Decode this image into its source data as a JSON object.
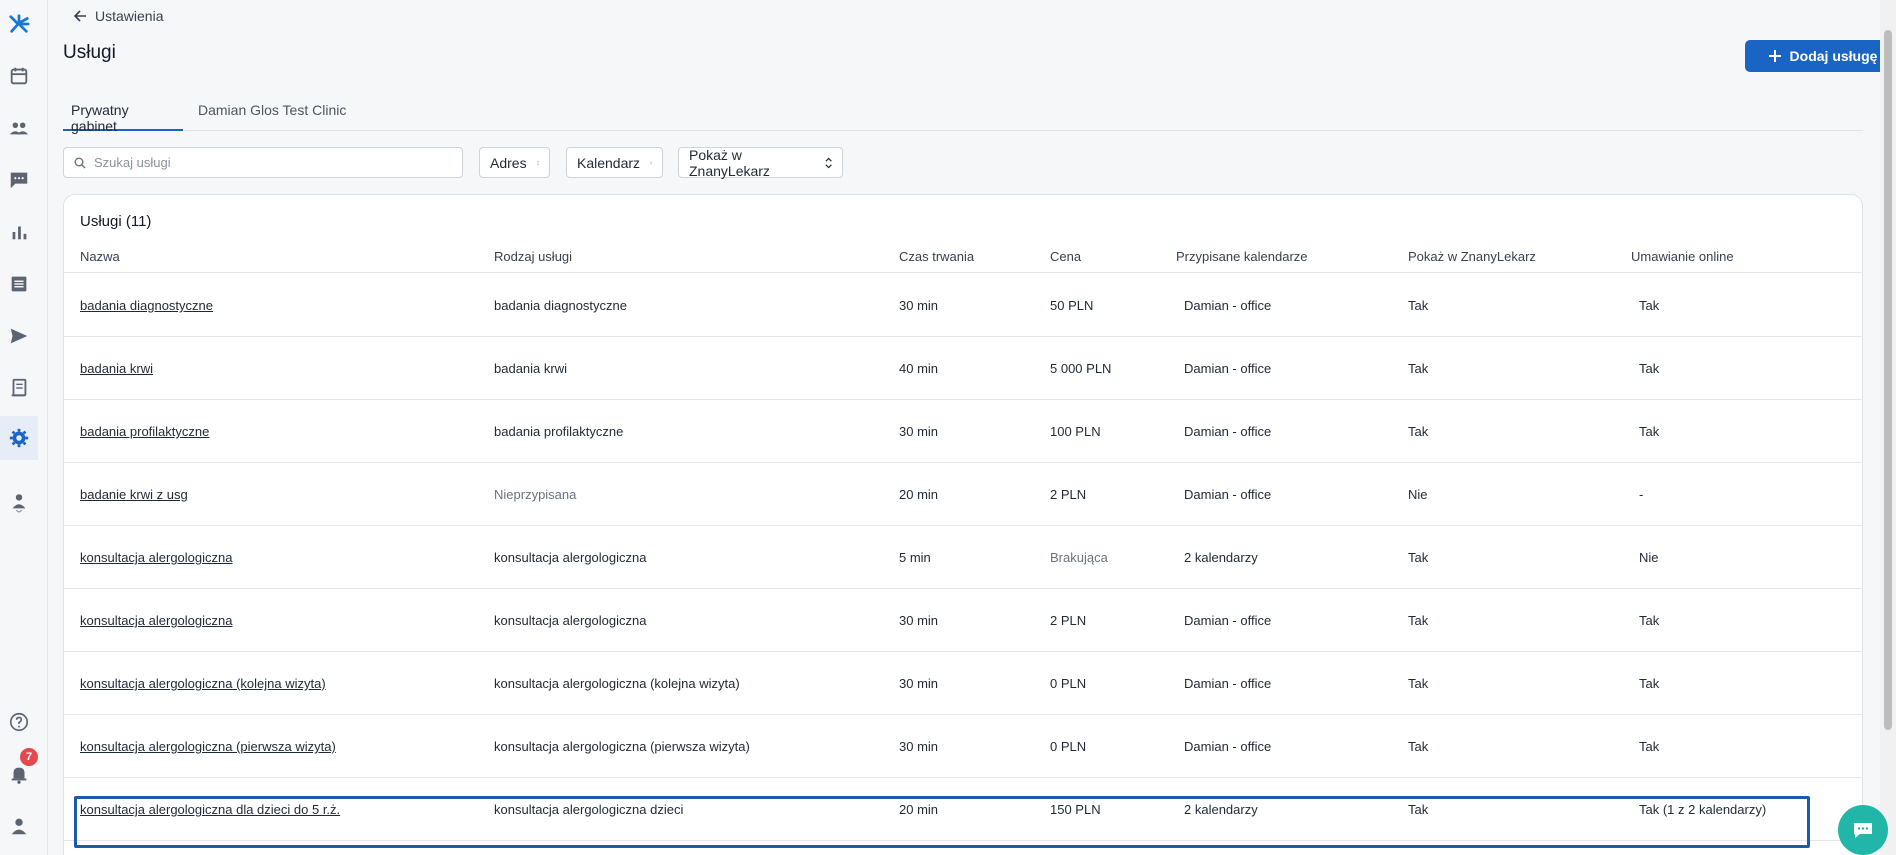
{
  "header": {
    "back_label": "Ustawienia",
    "title": "Usługi",
    "add_button_label": "Dodaj usługę"
  },
  "tabs": [
    {
      "label": "Prywatny gabinet",
      "active": true
    },
    {
      "label": "Damian Glos Test Clinic",
      "active": false
    }
  ],
  "search": {
    "placeholder": "Szukaj usługi",
    "value": ""
  },
  "filters": [
    {
      "label": "Adres"
    },
    {
      "label": "Kalendarz"
    },
    {
      "label": "Pokaż w ZnanyLekarz"
    }
  ],
  "table": {
    "title": "Usługi (11)",
    "columns": [
      "Nazwa",
      "Rodzaj usługi",
      "Czas trwania",
      "Cena",
      "Przypisane kalendarze",
      "Pokaż w ZnanyLekarz",
      "Umawianie online"
    ],
    "rows": [
      [
        "badania diagnostyczne",
        "badania diagnostyczne",
        "30 min",
        "50 PLN",
        "Damian - office",
        "Tak",
        "Tak"
      ],
      [
        "badania krwi",
        "badania krwi",
        "40 min",
        "5 000 PLN",
        "Damian - office",
        "Tak",
        "Tak"
      ],
      [
        "badania profilaktyczne",
        "badania profilaktyczne",
        "30 min",
        "100 PLN",
        "Damian - office",
        "Tak",
        "Tak"
      ],
      [
        "badanie krwi z usg",
        "Nieprzypisana",
        "20 min",
        "2 PLN",
        "Damian - office",
        "Nie",
        "-"
      ],
      [
        "konsultacja alergologiczna",
        "konsultacja alergologiczna",
        "5 min",
        "Brakująca",
        "2 kalendarzy",
        "Tak",
        "Nie"
      ],
      [
        "konsultacja alergologiczna",
        "konsultacja alergologiczna",
        "30 min",
        "2 PLN",
        "Damian - office",
        "Tak",
        "Tak"
      ],
      [
        "konsultacja alergologiczna (kolejna wizyta)",
        "konsultacja alergologiczna (kolejna wizyta)",
        "30 min",
        "0 PLN",
        "Damian - office",
        "Tak",
        "Tak"
      ],
      [
        "konsultacja alergologiczna (pierwsza wizyta)",
        "konsultacja alergologiczna (pierwsza wizyta)",
        "30 min",
        "0 PLN",
        "Damian - office",
        "Tak",
        "Tak"
      ],
      [
        "konsultacja alergologiczna dla dzieci do 5 r.ż.",
        "konsultacja alergologiczna dzieci",
        "20 min",
        "150 PLN",
        "2 kalendarzy",
        "Tak",
        "Tak (1 z 2 kalendarzy)"
      ]
    ]
  },
  "notifications": {
    "count": "7"
  },
  "colors": {
    "accent": "#1a64c4",
    "highlight": "#1e5aab",
    "chat": "#21b6a8",
    "badge": "#e5484d"
  },
  "sidebar_icons": [
    "logo-icon",
    "calendar-icon",
    "patients-icon",
    "messages-icon",
    "stats-icon",
    "list-icon",
    "send-icon",
    "documents-icon",
    "settings-icon",
    "staff-icon",
    "help-icon",
    "bell-icon",
    "user-icon"
  ]
}
